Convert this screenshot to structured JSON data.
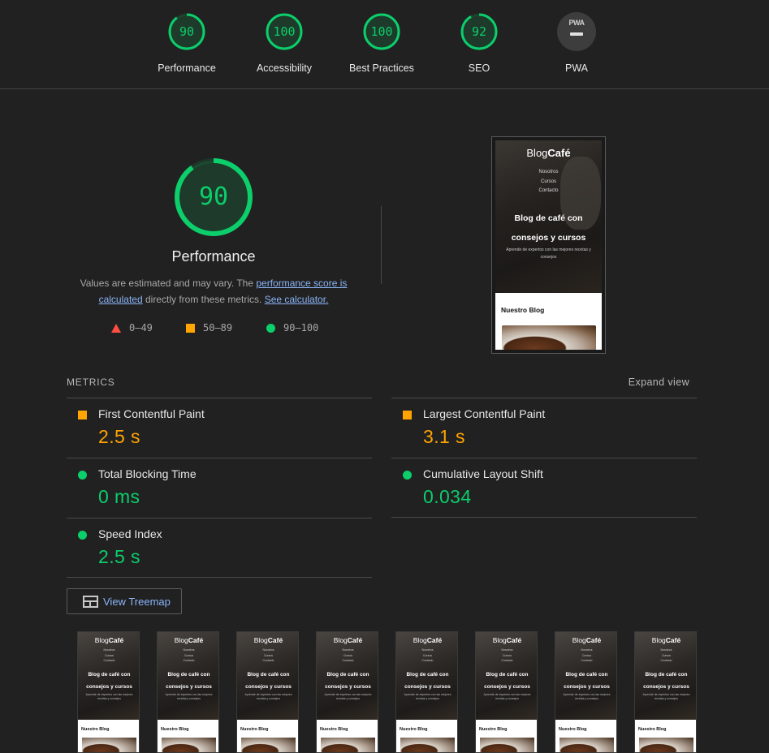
{
  "scores": [
    {
      "label": "Performance",
      "value": "90",
      "fraction": 0.9,
      "color": "#0cce6b"
    },
    {
      "label": "Accessibility",
      "value": "100",
      "fraction": 1.0,
      "color": "#0cce6b"
    },
    {
      "label": "Best Practices",
      "value": "100",
      "fraction": 1.0,
      "color": "#0cce6b"
    },
    {
      "label": "SEO",
      "value": "92",
      "fraction": 0.92,
      "color": "#0cce6b"
    }
  ],
  "pwa": {
    "label": "PWA",
    "badge": "PWA",
    "status": "—"
  },
  "performance": {
    "score": "90",
    "fraction": 0.9,
    "title": "Performance",
    "desc_prefix": "Values are estimated and may vary. The ",
    "desc_link1": "performance score is calculated",
    "desc_mid": " directly from these metrics. ",
    "desc_link2": "See calculator."
  },
  "legend": [
    {
      "range": "0–49",
      "shape": "triangle",
      "color": "#ff4e42"
    },
    {
      "range": "50–89",
      "shape": "square",
      "color": "#ffa400"
    },
    {
      "range": "90–100",
      "shape": "circle",
      "color": "#0cce6b"
    }
  ],
  "screenshot": {
    "logo_light": "Blog",
    "logo_bold": "Café",
    "nav": [
      "Nosotros",
      "Cursos",
      "Contacto"
    ],
    "headline": "Blog de café con consejos y cursos",
    "subtitle": "Aprende de expertos con las mejores recetas y consejos",
    "section_title": "Nuestro Blog"
  },
  "metrics": {
    "header": "METRICS",
    "expand_label": "Expand view",
    "items": [
      {
        "name": "First Contentful Paint",
        "value": "2.5 s",
        "status": "average"
      },
      {
        "name": "Largest Contentful Paint",
        "value": "3.1 s",
        "status": "average"
      },
      {
        "name": "Total Blocking Time",
        "value": "0 ms",
        "status": "pass"
      },
      {
        "name": "Cumulative Layout Shift",
        "value": "0.034",
        "status": "pass"
      },
      {
        "name": "Speed Index",
        "value": "2.5 s",
        "status": "pass"
      }
    ]
  },
  "treemap": {
    "label": "View Treemap"
  },
  "filmstrip": {
    "frame_count": 8,
    "logo_light": "Blog",
    "logo_bold": "Café",
    "nav": [
      "Nosotros",
      "Cursos",
      "Contacto"
    ],
    "headline": "Blog de café con consejos y cursos",
    "subtitle": "Aprende de expertos con las mejores recetas y consejos",
    "section_title": "Nuestro Blog"
  },
  "colors": {
    "pass": "#0cce6b",
    "average": "#ffa400",
    "fail": "#ff4e42",
    "link": "#8ab4f8",
    "background": "#212121"
  }
}
